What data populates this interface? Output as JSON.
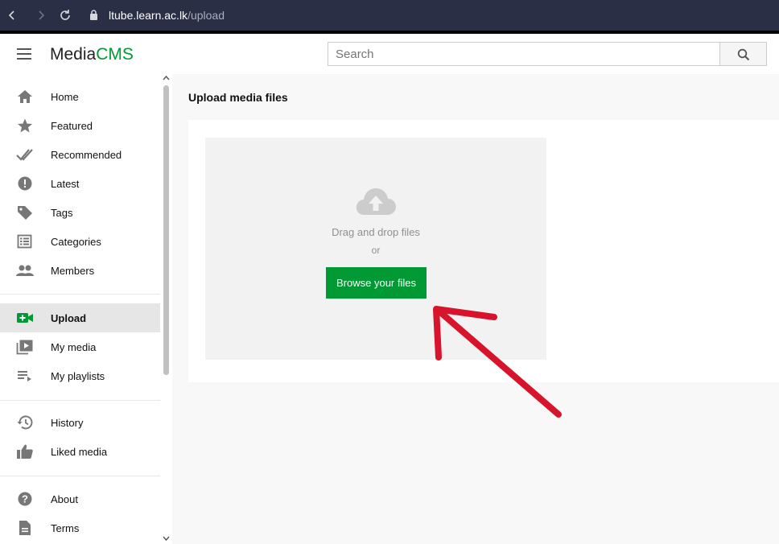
{
  "browser": {
    "url_host": "ltube.learn.ac.lk",
    "url_path": "/upload"
  },
  "header": {
    "brand_left": "Media",
    "brand_right": "CMS",
    "search_placeholder": "Search"
  },
  "sidebar": {
    "items": [
      {
        "label": "Home",
        "icon": "home-icon"
      },
      {
        "label": "Featured",
        "icon": "star-icon"
      },
      {
        "label": "Recommended",
        "icon": "double-check-icon"
      },
      {
        "label": "Latest",
        "icon": "new-badge-icon"
      },
      {
        "label": "Tags",
        "icon": "tag-icon"
      },
      {
        "label": "Categories",
        "icon": "list-icon"
      },
      {
        "label": "Members",
        "icon": "people-icon"
      },
      {
        "label": "Upload",
        "icon": "video-add-icon",
        "active": true
      },
      {
        "label": "My media",
        "icon": "video-library-icon"
      },
      {
        "label": "My playlists",
        "icon": "playlist-icon"
      },
      {
        "label": "History",
        "icon": "history-icon"
      },
      {
        "label": "Liked media",
        "icon": "thumb-up-icon"
      },
      {
        "label": "About",
        "icon": "help-icon"
      },
      {
        "label": "Terms",
        "icon": "document-icon"
      }
    ]
  },
  "main": {
    "title": "Upload media files",
    "dropzone": {
      "drag_text": "Drag and drop files",
      "or_text": "or",
      "browse_label": "Browse your files"
    }
  },
  "colors": {
    "accent": "#009933",
    "annotation_arrow": "#d7142b",
    "browser_bar": "#2a2f45"
  }
}
